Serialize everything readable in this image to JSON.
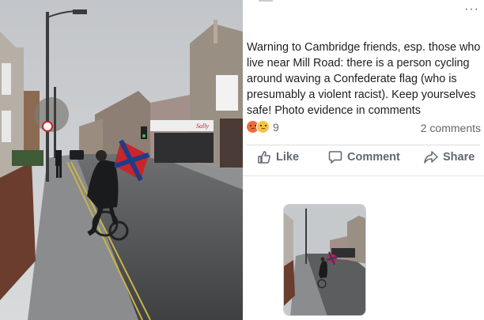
{
  "post": {
    "text": "Warning to Cambridge friends, esp. those who live near Mill Road: there is a person cycling around waving a Confederate flag (who is presumably a violent racist). Keep yourselves safe! Photo evidence in comments",
    "reaction_count": "9",
    "comments_label": "2 comments",
    "more_label": "···"
  },
  "actions": {
    "like": "Like",
    "comment": "Comment",
    "share": "Share"
  },
  "icons": {
    "like": "thumbs-up-icon",
    "comment": "speech-bubble-icon",
    "share": "share-arrow-icon",
    "reactions": [
      "angry-reaction-icon",
      "sad-reaction-icon"
    ]
  },
  "shop_sign": "Sally",
  "colors": {
    "text": "#1c1e21",
    "secondary": "#606770",
    "angry": "#f36b3a",
    "sad": "#f7c443",
    "flag_red": "#c8262c",
    "flag_blue": "#1f3c88"
  }
}
